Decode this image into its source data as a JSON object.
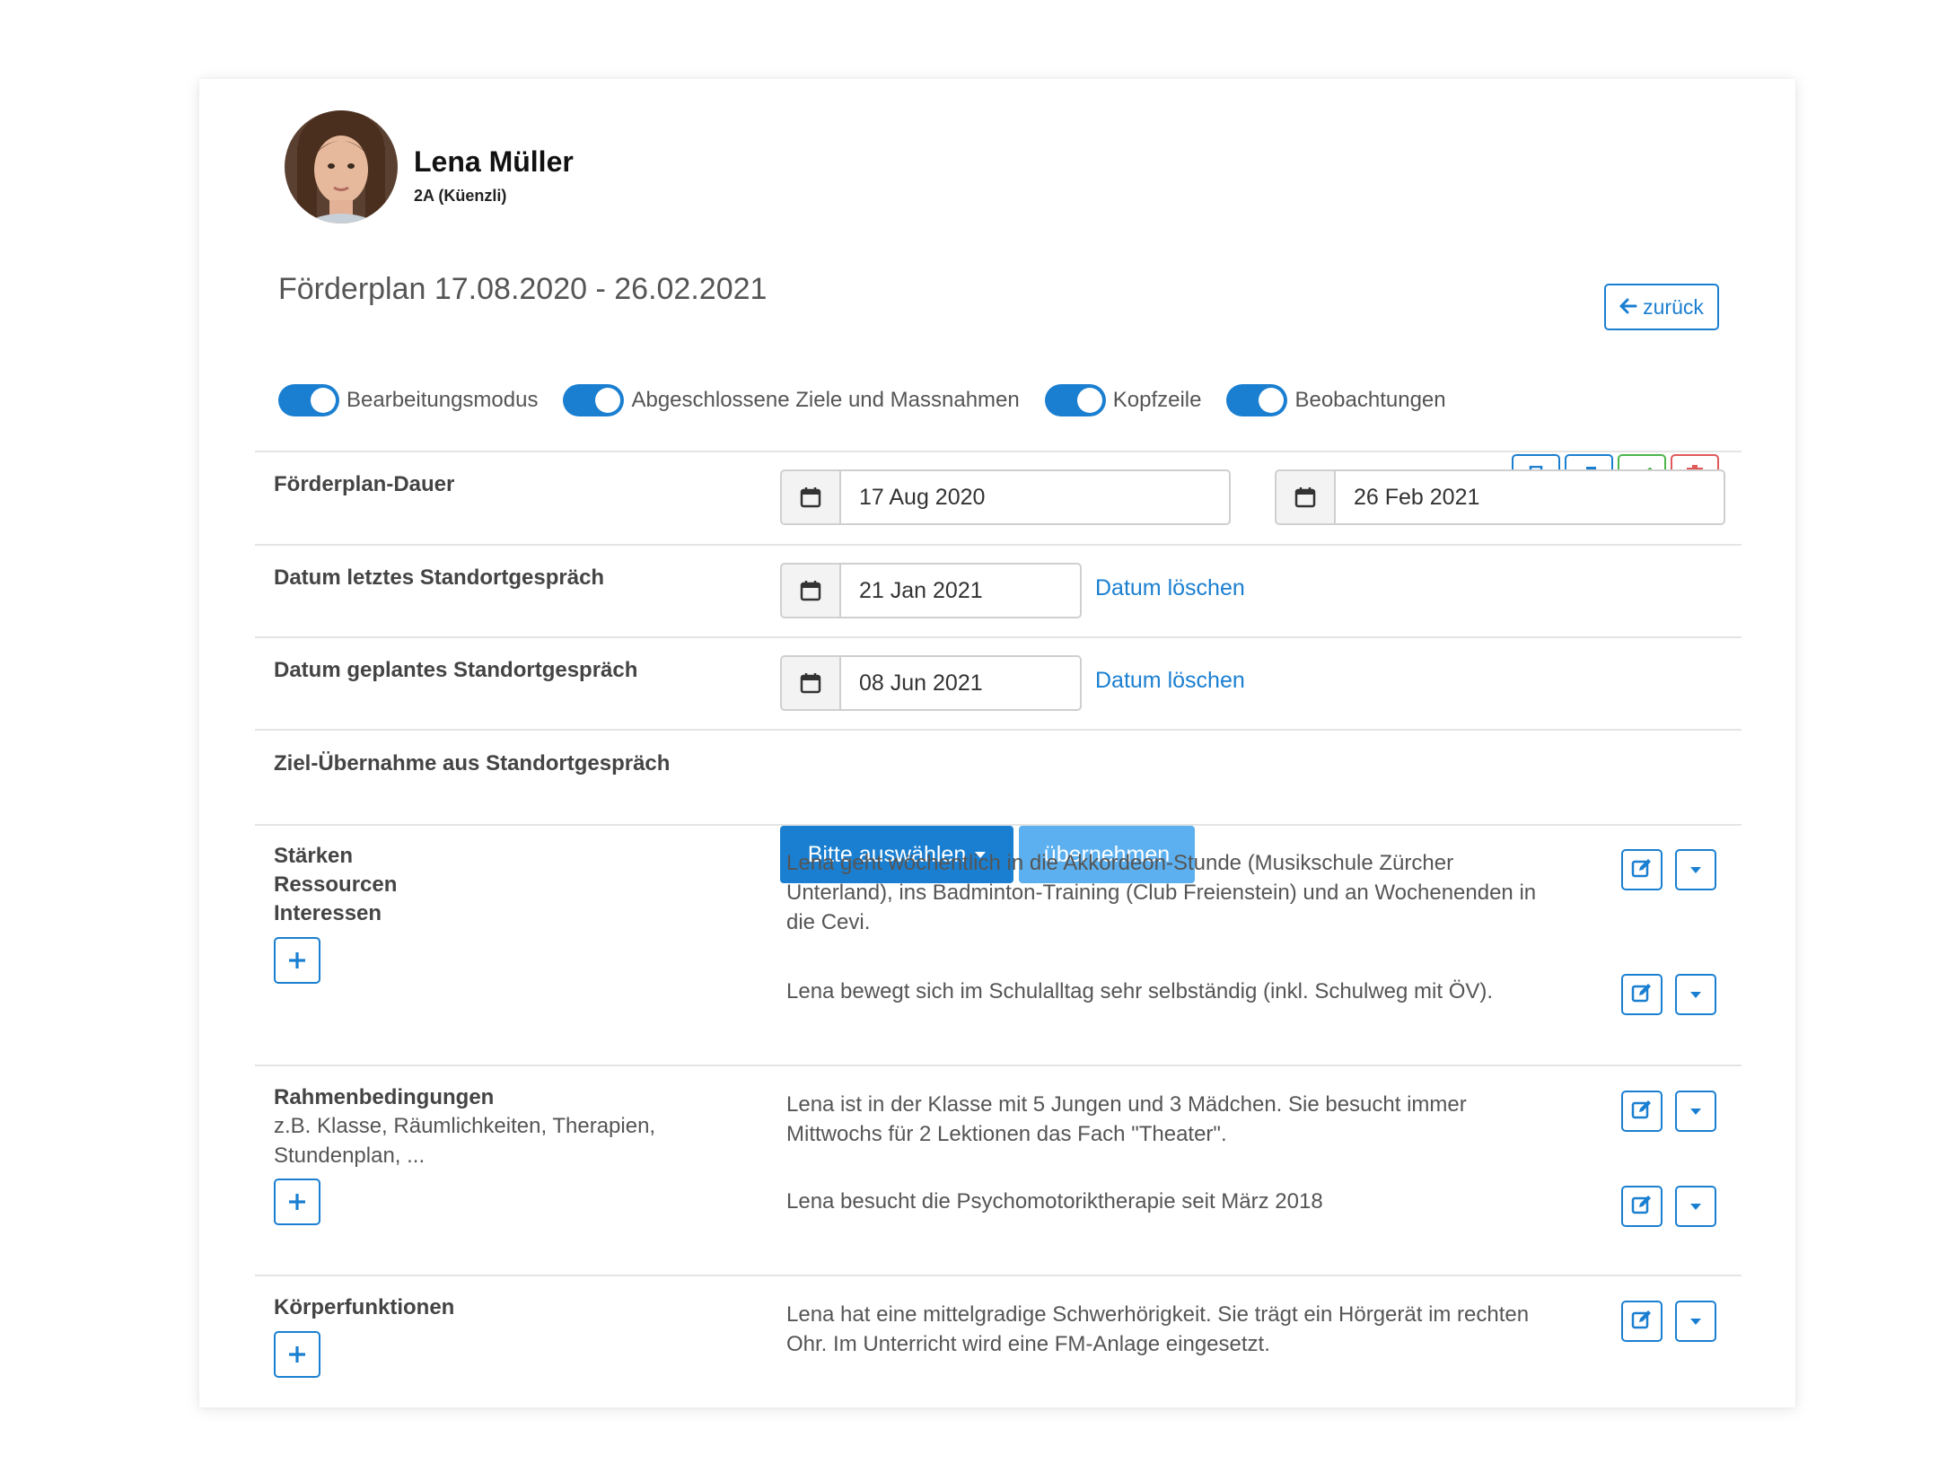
{
  "student": {
    "name": "Lena Müller",
    "class": "2A (Küenzli)"
  },
  "plan_title": "Förderplan 17.08.2020 - 26.02.2021",
  "back_label": "zurück",
  "toggles": [
    {
      "label": "Bearbeitungsmodus",
      "on": true
    },
    {
      "label": "Abgeschlossene Ziele und Massnahmen",
      "on": true
    },
    {
      "label": "Kopfzeile",
      "on": true
    },
    {
      "label": "Beobachtungen",
      "on": true
    }
  ],
  "toolbar": {
    "icons": [
      "print-icon",
      "copy-icon",
      "check-icon",
      "trash-icon"
    ],
    "colors": {
      "primary": "#1a7fd1",
      "success": "#4cb54c",
      "danger": "#e05a5a"
    }
  },
  "rows": {
    "duration": {
      "label": "Förderplan-Dauer",
      "start": "17 Aug 2020",
      "end": "26 Feb 2021"
    },
    "last_meeting": {
      "label": "Datum letztes Standortgespräch",
      "date": "21 Jan 2021",
      "clear": "Datum löschen"
    },
    "planned_meeting": {
      "label": "Datum geplantes Standortgespräch",
      "date": "08 Jun 2021",
      "clear": "Datum löschen"
    },
    "goal_import": {
      "label": "Ziel-Übernahme aus Standortgespräch",
      "select": "Bitte auswählen",
      "apply": "übernehmen"
    }
  },
  "sections": {
    "strengths": {
      "label1": "Stärken",
      "label2": "Ressourcen",
      "label3": "Interessen",
      "entries": [
        "Lena geht wöchentlich in die Akkordeon-Stunde (Musikschule Zürcher Unterland), ins Badminton-Training (Club Freienstein) und an Wochenenden in die Cevi.",
        "Lena bewegt sich im Schulalltag sehr selbständig (inkl. Schulweg mit ÖV)."
      ]
    },
    "conditions": {
      "label": "Rahmenbedingungen",
      "hint": "z.B. Klasse, Räumlichkeiten, Therapien, Stundenplan, ...",
      "entries": [
        "Lena ist in der Klasse mit 5 Jungen und 3 Mädchen. Sie besucht immer Mittwochs für 2 Lektionen das Fach \"Theater\".",
        "Lena besucht die Psychomotoriktherapie seit März 2018"
      ]
    },
    "body_functions": {
      "label": "Körperfunktionen",
      "entries": [
        "Lena hat eine mittelgradige Schwerhörigkeit. Sie trägt ein Hörgerät im rechten Ohr. Im Unterricht wird eine FM-Anlage eingesetzt."
      ]
    }
  }
}
